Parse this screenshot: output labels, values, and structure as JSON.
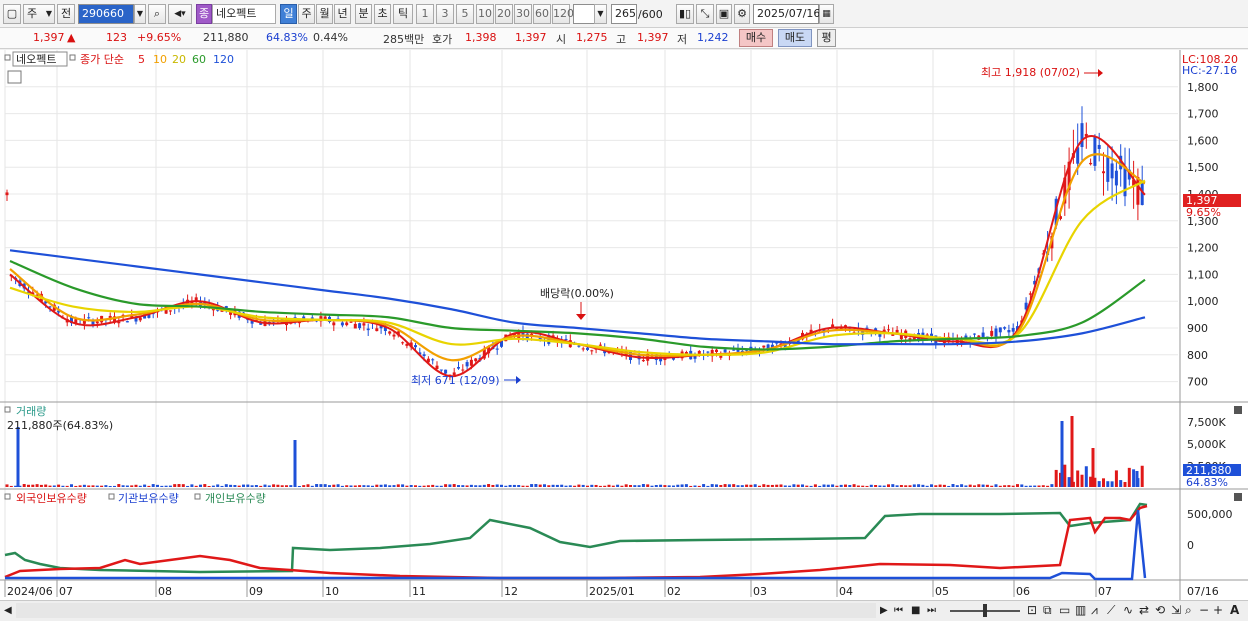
{
  "toolbar": {
    "market_label": "주",
    "prev_label": "전",
    "code": "290660",
    "stock_tag": "종",
    "stock_name": "네오펙트",
    "periods": [
      "일",
      "주",
      "월",
      "년",
      "분",
      "초",
      "틱"
    ],
    "active_period": "일",
    "intervals": [
      "1",
      "3",
      "5",
      "10",
      "20",
      "30",
      "60",
      "120"
    ],
    "count_value": "265",
    "count_max": "/600",
    "date": "2025/07/16"
  },
  "quote": {
    "price": "1,397",
    "change_arrow": "▲",
    "change": "123",
    "change_pct": "+9.65%",
    "volume": "211,880",
    "volume_ratio": "64.83%",
    "turnover": "0.44%",
    "amount": "285백만",
    "ask_label": "호가",
    "ask_price": "1,398",
    "bid_price": "1,397",
    "open_label": "시",
    "open": "1,275",
    "high_label": "고",
    "high": "1,397",
    "low_label": "저",
    "low": "1,242",
    "buy_label": "매수",
    "sell_label": "매도",
    "avg_label": "평"
  },
  "price_panel": {
    "name_tag": "네오펙트",
    "ma_label": "종가 단순",
    "ma_periods": [
      "5",
      "10",
      "20",
      "60",
      "120"
    ],
    "ma_colors": [
      "#e01818",
      "#f2a000",
      "#e8d400",
      "#2a9a2a",
      "#1e50d8"
    ],
    "lc": "LC:108.20",
    "hc": "HC:-27.16",
    "y_ticks": [
      "1,800",
      "1,700",
      "1,600",
      "1,500",
      "1,400",
      "1,300",
      "1,200",
      "1,100",
      "1,000",
      "900",
      "800",
      "700"
    ],
    "current_price_tag": "1,397",
    "current_pct_tag": "9.65%",
    "high_annotation": "최고 1,918 (07/02)",
    "low_annotation": "최저 671 (12/09)",
    "dividend_annotation": "배당락(0.00%)"
  },
  "volume_panel": {
    "title": "거래량",
    "value": "211,880주(64.83%)",
    "y_ticks": [
      "7,500K",
      "5,000K",
      "2,500K"
    ],
    "current_tag": "211,880",
    "current_pct_tag": "64.83%"
  },
  "holding_panel": {
    "legend": [
      "외국인보유수량",
      "기관보유수량",
      "개인보유수량"
    ],
    "legend_colors": [
      "#e01818",
      "#1e50d8",
      "#2a8a55"
    ],
    "y_ticks": [
      "500,000",
      "0"
    ]
  },
  "x_axis": {
    "labels": [
      "2024/06",
      "07",
      "08",
      "09",
      "10",
      "11",
      "12",
      "2025/01",
      "02",
      "03",
      "04",
      "05",
      "06",
      "07"
    ],
    "end_label": "07/16"
  },
  "chart_data": [
    {
      "type": "candlestick",
      "title": "네오펙트",
      "x": [
        "2024/06",
        "07",
        "08",
        "09",
        "10",
        "11",
        "12",
        "2025/01",
        "02",
        "03",
        "04",
        "05",
        "06",
        "07"
      ],
      "ylim": [
        650,
        1900
      ],
      "series": [
        {
          "name": "5",
          "values": [
            1100,
            920,
            940,
            1000,
            920,
            930,
            900,
            720,
            880,
            840,
            790,
            800,
            820,
            900,
            880,
            850,
            900,
            1600,
            1397
          ]
        },
        {
          "name": "10",
          "values": [
            1120,
            940,
            950,
            990,
            930,
            930,
            910,
            780,
            870,
            840,
            800,
            800,
            820,
            890,
            880,
            860,
            890,
            1520,
            1440
          ]
        },
        {
          "name": "20",
          "values": [
            1050,
            980,
            960,
            980,
            940,
            930,
            920,
            840,
            860,
            840,
            810,
            800,
            810,
            870,
            880,
            860,
            880,
            1300,
            1450
          ]
        },
        {
          "name": "60",
          "values": [
            1150,
            1050,
            990,
            980,
            960,
            950,
            940,
            900,
            890,
            880,
            860,
            830,
            820,
            830,
            850,
            860,
            870,
            920,
            1080
          ]
        },
        {
          "name": "120",
          "values": [
            1190,
            1160,
            1130,
            1100,
            1070,
            1040,
            1010,
            970,
            920,
            900,
            880,
            860,
            850,
            840,
            840,
            840,
            850,
            880,
            940
          ]
        }
      ]
    },
    {
      "type": "bar",
      "title": "거래량",
      "x": [
        "2024/06",
        "07",
        "08",
        "09",
        "10",
        "11",
        "12",
        "2025/01",
        "02",
        "03",
        "04",
        "05",
        "06",
        "07"
      ],
      "ylim": [
        0,
        9000
      ],
      "last_value": 211880
    },
    {
      "type": "line",
      "x": [
        "2024/06",
        "07",
        "08",
        "09",
        "10",
        "11",
        "12",
        "2025/01",
        "02",
        "03",
        "04",
        "05",
        "06",
        "07"
      ],
      "series": [
        {
          "name": "외국인보유수량"
        },
        {
          "name": "기관보유수량"
        },
        {
          "name": "개인보유수량"
        }
      ],
      "y_ticks": [
        500000,
        0
      ]
    }
  ]
}
